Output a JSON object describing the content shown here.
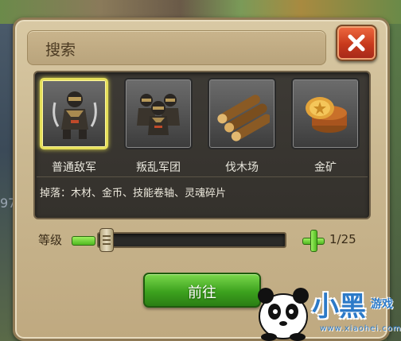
{
  "background": {
    "side_number": "97"
  },
  "dialog": {
    "title": "搜索",
    "close_icon": "close-x-icon",
    "categories": [
      {
        "label": "普通敌军",
        "icon": "ninja-soldier-icon",
        "selected": true
      },
      {
        "label": "叛乱军团",
        "icon": "ninja-squad-icon",
        "selected": false
      },
      {
        "label": "伐木场",
        "icon": "wood-logs-icon",
        "selected": false
      },
      {
        "label": "金矿",
        "icon": "gold-coins-icon",
        "selected": false
      }
    ],
    "drops_text": "掉落：木材、金币、技能卷轴、灵魂碎片",
    "level": {
      "label": "等级",
      "current": "1",
      "max": "25",
      "display": "1/25"
    },
    "go_button": "前往"
  },
  "watermark": {
    "brand": "小黑",
    "brand_suffix": "游戏",
    "url": "www.xiaohei.com"
  },
  "colors": {
    "accent_green": "#3da21e",
    "close_red": "#c7391c",
    "selected_border": "#e6e05a"
  }
}
